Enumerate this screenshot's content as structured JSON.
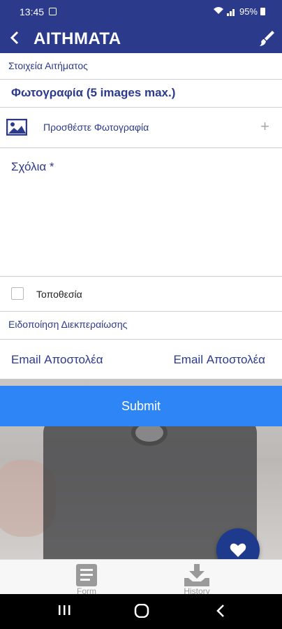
{
  "status_bar": {
    "time": "13:45",
    "battery": "95%"
  },
  "app_bar": {
    "title": "ΑΙΤΗΜΑΤΑ"
  },
  "request_section": {
    "title": "Στοιχεία Αιτήματος"
  },
  "photos": {
    "title": "Φωτογραφία (5 images max.)",
    "add_label": "Προσθέστε Φωτογραφία",
    "add_icon": "+"
  },
  "comments": {
    "label": "Σχόλια *"
  },
  "location": {
    "label": "Τοποθεσία",
    "checked": false
  },
  "notification_section": {
    "title": "Ειδοποίηση Διεκπεραίωσης"
  },
  "email": {
    "label": "Email Αποστολέα",
    "value": "Email Αποστολέα"
  },
  "submit": {
    "label": "Submit"
  },
  "bottom_nav": {
    "form": "Form",
    "history": "History"
  },
  "colors": {
    "primary": "#2c3a8c",
    "submit": "#2e86f6",
    "fab": "#1d3a8c"
  }
}
